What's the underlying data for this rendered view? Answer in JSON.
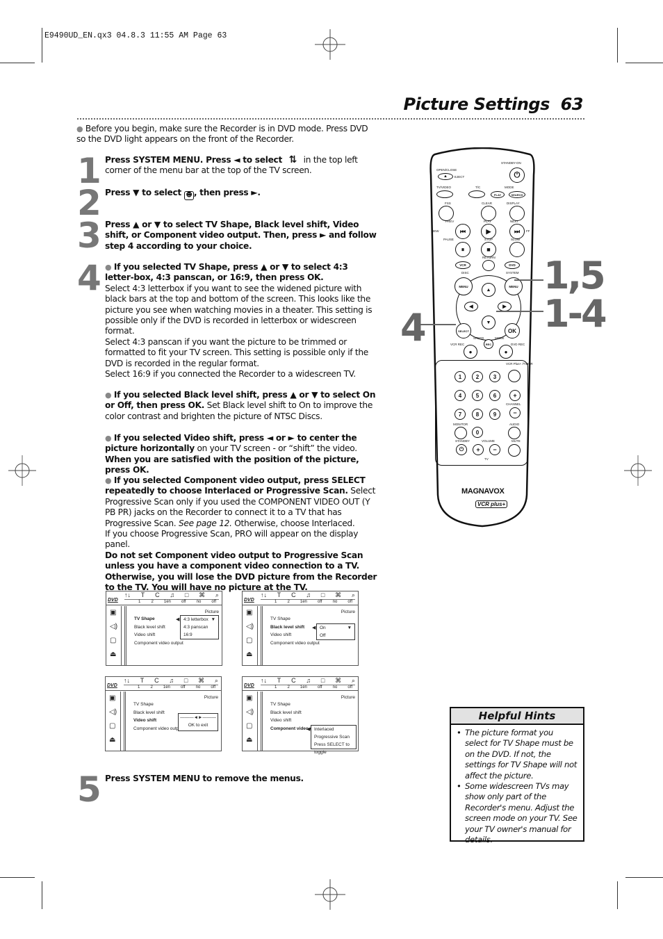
{
  "slug": "E9490UD_EN.qx3  04.8.3  11:55 AM  Page 63",
  "header": {
    "title": "Picture Settings",
    "page_number": "63"
  },
  "intro": "Before you begin, make sure the Recorder is in DVD mode. Press DVD so the DVD light appears on the front of the Recorder.",
  "steps": [
    {
      "number": "1",
      "bold": "Press SYSTEM MENU. Press ◄ to select",
      "icon": "setup-icon",
      "rest": "in the top left corner of the menu bar at the top of the TV screen."
    },
    {
      "number": "2",
      "bold_a": "Press ▼ to select",
      "icon": "picture-icon",
      "bold_b": ", then press ►."
    },
    {
      "number": "3",
      "bold": "Press ▲ or ▼ to select TV Shape, Black level shift, Video shift, or Component video output. Then, press ► and follow step 4 according to your choice."
    },
    {
      "number": "4",
      "tvshape": {
        "bold": "If you selected TV Shape, press ▲ or ▼ to select 4:3 letter-box, 4:3 panscan, or 16:9, then press OK.",
        "p1": "Select 4:3 letterbox if you want to see the widened picture with black bars at the top and bottom of the screen. This looks like the picture you see when watching movies in a theater. This setting is possible only if the DVD is recorded in letterbox or widescreen format.",
        "p2": "Select 4:3 panscan if you want the picture to be trimmed or formatted to fit your TV screen. This setting is possible only if the DVD is recorded in the regular format.",
        "p3": "Select 16:9 if you connected the Recorder to a widescreen TV."
      },
      "blacklevel": {
        "bold": "If you selected Black level shift, press ▲ or ▼ to select On or Off, then press OK.",
        "rest": "Set Black level shift to On to improve the color contrast and brighten the picture of NTSC Discs."
      },
      "videoshift": {
        "bold_a": "If you selected Video shift, press ◄ or ► to center the picture horizontally",
        "mid": "on your TV screen - or “shift” the video.",
        "bold_b": "When you are satisfied with the position of the picture, press OK."
      },
      "component": {
        "bold": "If you selected Component video output, press SELECT repeatedly to choose Interlaced or Progressive Scan.",
        "r1": "Select Progressive Scan only if you used the COMPONENT VIDEO OUT (Y PB PR) jacks on the Recorder to connect it to a TV that has Progressive Scan.",
        "italic": "See page 12.",
        "r2": "Otherwise, choose Interlaced.",
        "r3": "If you choose Progressive Scan, PRO will appear on the display panel.",
        "warning": "Do not set Component video output to Progressive Scan unless you have a component video connection to a TV. Otherwise, you will lose the DVD picture from the Recorder to the TV. You will have no picture at the TV."
      }
    },
    {
      "number": "5",
      "bold": "Press SYSTEM MENU",
      "rest": "to remove the menus."
    }
  ],
  "menus": {
    "logo": "DVD",
    "top_icons": [
      "↑↓",
      "T",
      "C",
      "♫",
      "□",
      "⌘",
      "⌕"
    ],
    "top_values": [
      "1",
      "2",
      "1en",
      "off",
      "no",
      "off"
    ],
    "panel_title": "Picture",
    "rows": [
      "TV Shape",
      "Black level shift",
      "Video shift",
      "Component video output"
    ],
    "screen1": {
      "selected": 0,
      "options": [
        "4:3 letterbox",
        "4:3 panscan",
        "16:9"
      ]
    },
    "screen2": {
      "selected": 1,
      "options": [
        "On",
        "Off"
      ]
    },
    "screen3": {
      "selected": 2,
      "slider": "———◄►———",
      "hint": "OK to exit"
    },
    "screen4": {
      "selected": 3,
      "options": [
        "Interlaced",
        "Progressive Scan",
        "Press SELECT to toggle"
      ]
    }
  },
  "remote": {
    "labels": {
      "open_close": "OPEN/CLOSE",
      "eject": "EJECT",
      "standby_on": "STANDBY-ON",
      "tv_video": "TV/VIDEO",
      "tc": "T/C",
      "mode": "MODE",
      "play_mode": "PLAY",
      "search_mode": "SEARCH",
      "fss": "FSS",
      "clear": "CLEAR",
      "display": "DISPLAY",
      "prev": "PREV",
      "play": "PLAY",
      "next": "NEXT",
      "rew": "REW",
      "ff": "FF",
      "pause": "PAUSE",
      "stop": "STOP",
      "slow": "SLOW",
      "return": "RETURN",
      "vcr": "VCR",
      "dvd": "DVD",
      "disc": "DISC",
      "system": "SYSTEM",
      "menu": "MENU",
      "select": "SELECT",
      "ok": "OK",
      "speed": "SPEED",
      "mode2": "MODE",
      "rec": "REC",
      "vcr_rec": "VCR REC",
      "dvd_rec": "DVD REC",
      "vcrplus": "VCR Plus+ /TIMER",
      "channel": "CHANNEL",
      "monitor": "MONITOR",
      "audio": "AUDIO",
      "standby": "STANDBY",
      "volume": "VOLUME",
      "mute": "MUTE",
      "tv": "TV",
      "brand": "MAGNAVOX",
      "vcrplus_logo": "VCR plus+"
    },
    "digits": [
      "1",
      "2",
      "3",
      "4",
      "5",
      "6",
      "7",
      "8",
      "9",
      "0"
    ],
    "callouts": [
      "1,5",
      "1-4",
      "4"
    ]
  },
  "hints": {
    "title": "Helpful Hints",
    "items": [
      "The picture format you select for TV Shape must be on the DVD. If not, the settings for TV Shape will not affect the picture.",
      "Some widescreen TVs may show only part of the Recorder's menu. Adjust the screen mode on your TV. See your TV owner's manual for details."
    ]
  }
}
